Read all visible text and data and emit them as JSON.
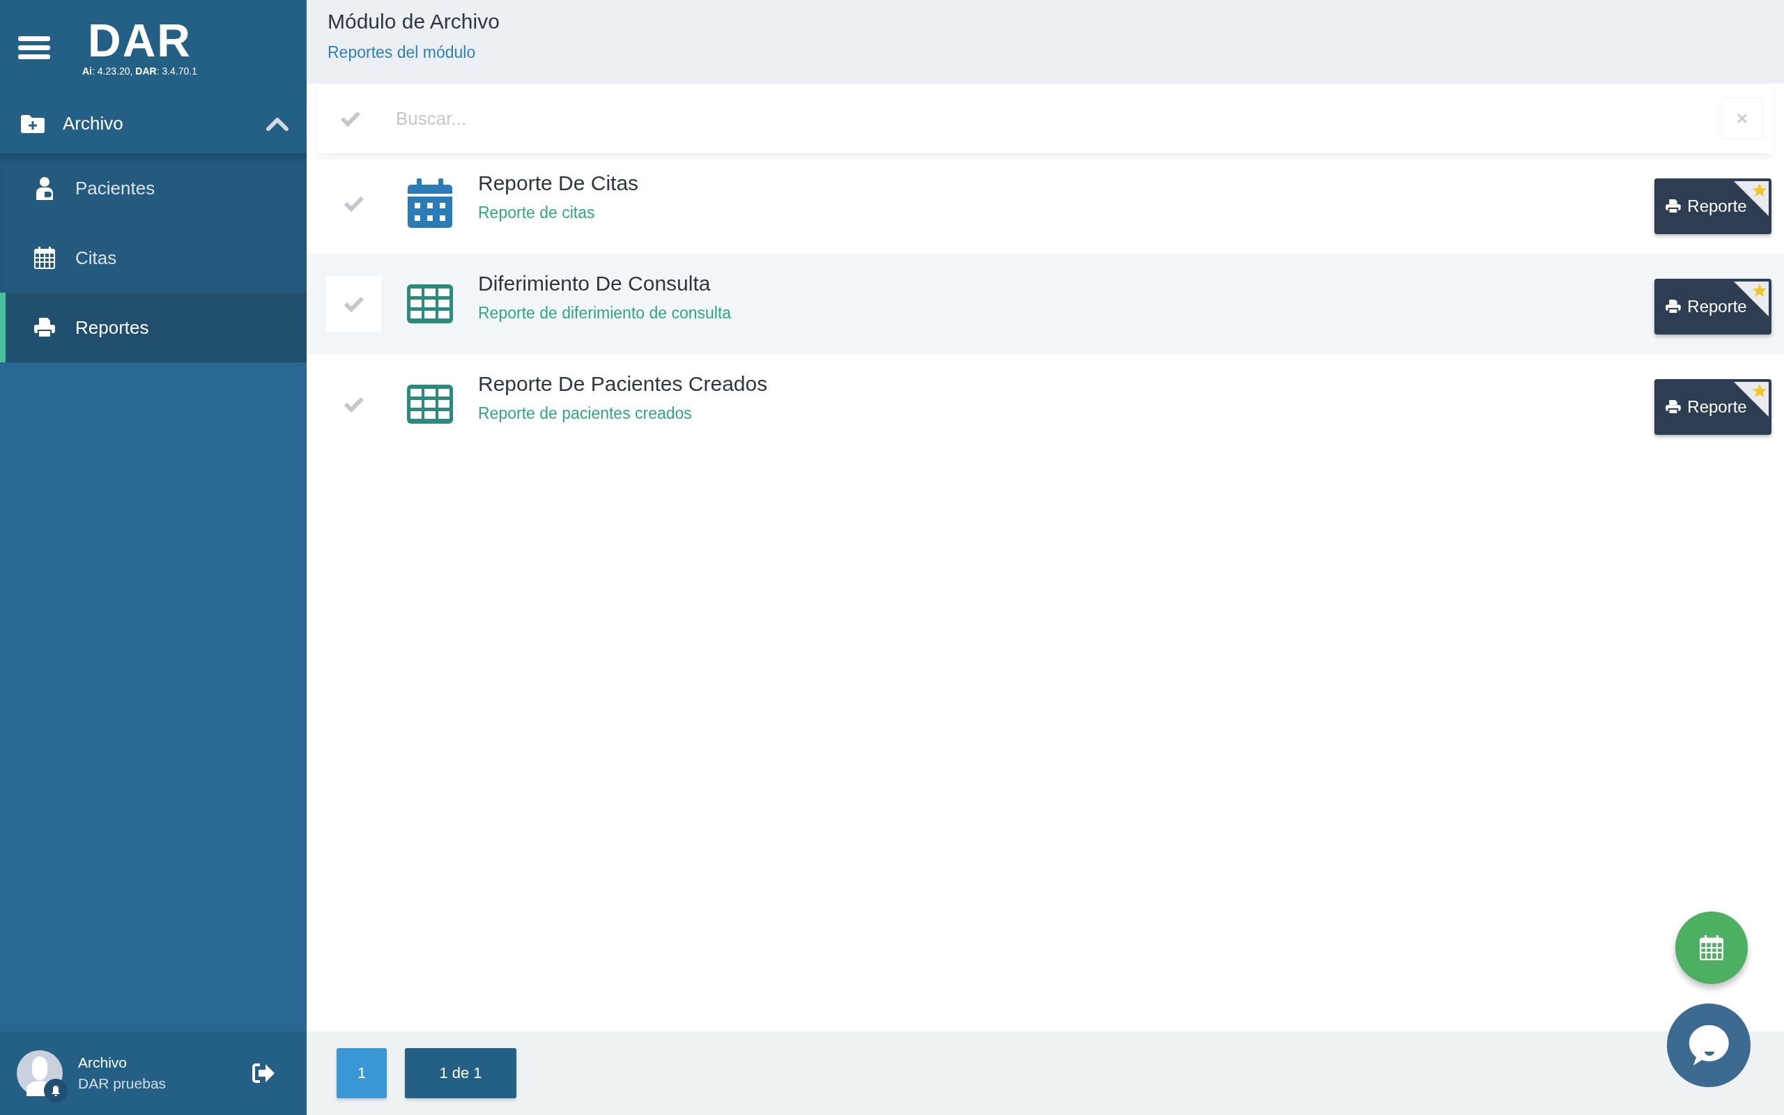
{
  "sidebar": {
    "logo": "DAR",
    "version": "**Ai**: 4.23.20, **DAR**: 3.4.70.1",
    "section": {
      "label": "Archivo",
      "expanded": true
    },
    "items": [
      {
        "label": "Pacientes",
        "kind": "patient",
        "selected": false
      },
      {
        "label": "Citas",
        "kind": "calendar",
        "selected": false
      },
      {
        "label": "Reportes",
        "kind": "printer",
        "selected": true
      }
    ],
    "user": {
      "name": "Archivo",
      "subtitle": "DAR pruebas"
    }
  },
  "header": {
    "title": "Módulo de Archivo",
    "subtitle": "Reportes del módulo"
  },
  "search": {
    "placeholder": "Buscar..."
  },
  "reports": [
    {
      "title": "Reporte De Citas",
      "description": "Reporte de citas",
      "kind": "calendar",
      "selected": false,
      "button": "Reporte"
    },
    {
      "title": "Diferimiento De Consulta",
      "description": "Reporte de diferimiento de consulta",
      "kind": "table",
      "selected": true,
      "button": "Reporte"
    },
    {
      "title": "Reporte De Pacientes Creados",
      "description": "Reporte de pacientes creados",
      "kind": "table",
      "selected": false,
      "button": "Reporte"
    }
  ],
  "pagination": {
    "pages": [
      {
        "label": "1",
        "selected": true
      }
    ],
    "summary": "1 de 1"
  }
}
